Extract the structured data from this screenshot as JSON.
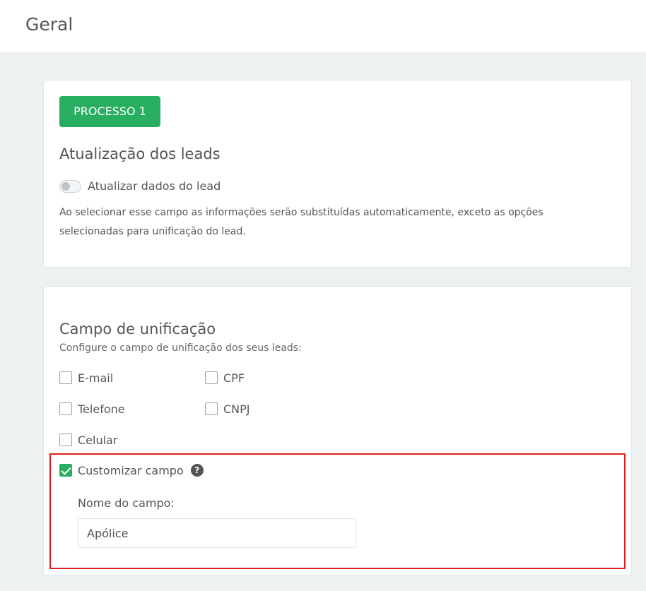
{
  "header": {
    "title": "Geral"
  },
  "card1": {
    "process_button": "PROCESSO 1",
    "title": "Atualização dos leads",
    "toggle_label": "Atualizar dados do lead",
    "toggle_on": false,
    "description": "Ao selecionar esse campo as informações serão substituídas automaticamente, exceto as opções selecionadas para unificação do lead."
  },
  "card2": {
    "title": "Campo de unificação",
    "subtitle": "Configure o campo de unificação dos seus leads:",
    "options": [
      {
        "label": "E-mail",
        "checked": false
      },
      {
        "label": "CPF",
        "checked": false
      },
      {
        "label": "Telefone",
        "checked": false
      },
      {
        "label": "CNPJ",
        "checked": false
      },
      {
        "label": "Celular",
        "checked": false
      }
    ],
    "custom": {
      "label": "Customizar campo",
      "checked": true,
      "help_icon": "?"
    },
    "field_label": "Nome do campo:",
    "field_value": "Apólice"
  },
  "colors": {
    "accent": "#27ae60",
    "highlight": "#e01e1e"
  }
}
